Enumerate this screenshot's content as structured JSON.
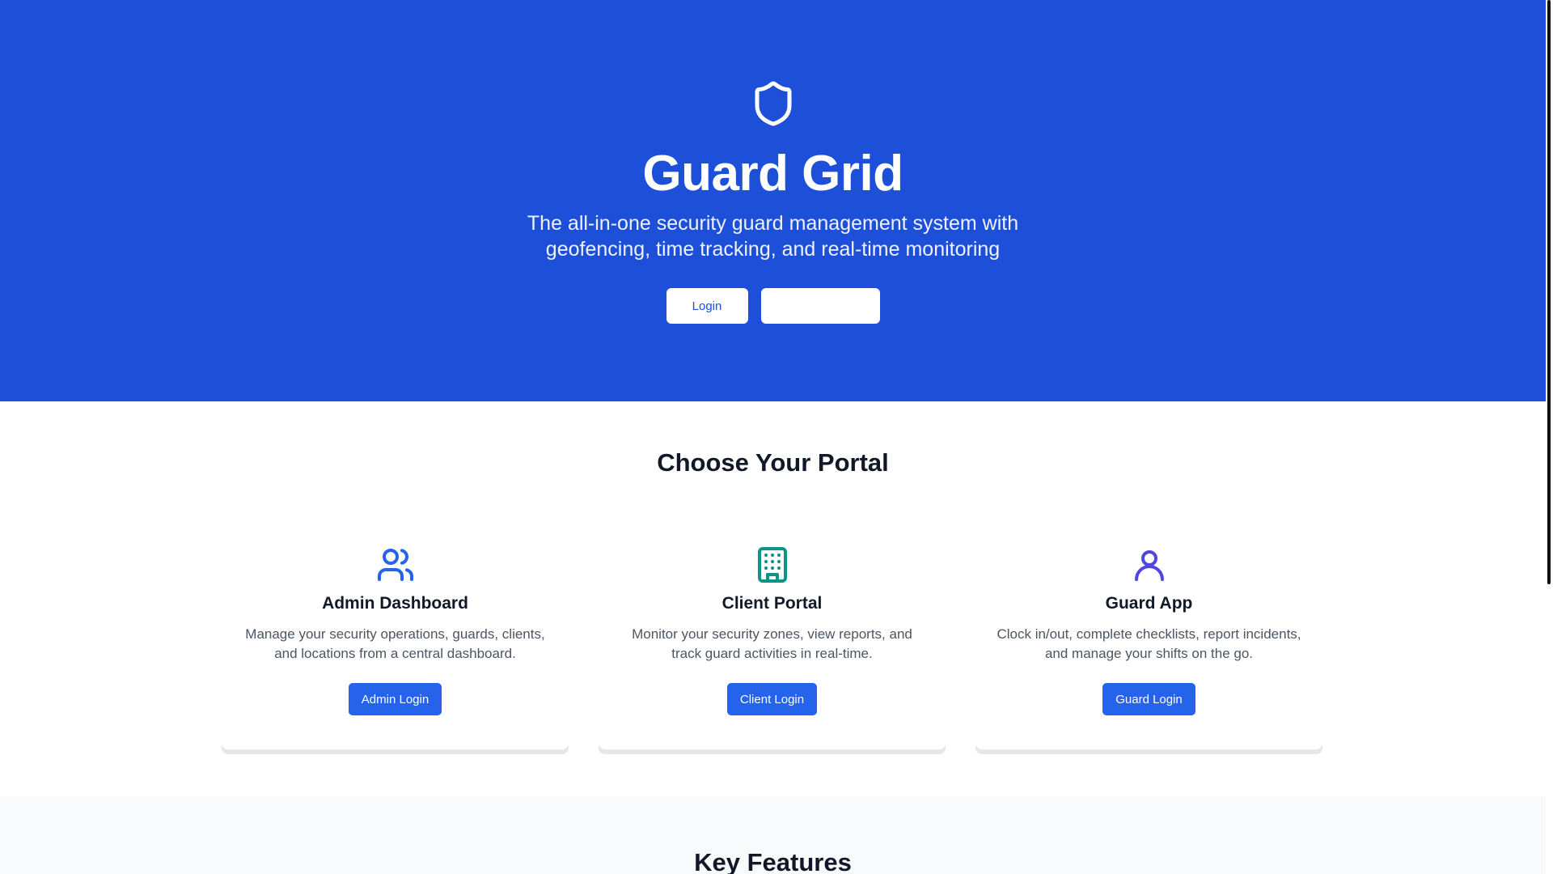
{
  "hero": {
    "icon": "shield-icon",
    "title": "Guard Grid",
    "subtitle": "The all-in-one security guard management system with geofencing, time tracking, and real-time monitoring",
    "login_label": "Login",
    "secondary_label": ""
  },
  "portals": {
    "heading": "Choose Your Portal",
    "cards": [
      {
        "icon": "users-icon",
        "title": "Admin Dashboard",
        "description": "Manage your security operations, guards, clients, and locations from a central dashboard.",
        "button": "Admin Login",
        "icon_color": "#2563eb"
      },
      {
        "icon": "building-icon",
        "title": "Client Portal",
        "description": "Monitor your security zones, view reports, and track guard activities in real-time.",
        "button": "Client Login",
        "icon_color": "#0d9488"
      },
      {
        "icon": "user-icon",
        "title": "Guard App",
        "description": "Clock in/out, complete checklists, report incidents, and manage your shifts on the go.",
        "button": "Guard Login",
        "icon_color": "#4f46e5"
      }
    ]
  },
  "features": {
    "heading": "Key Features"
  },
  "colors": {
    "hero_bg": "#1d4fd8",
    "primary_button": "#2563eb",
    "features_bg": "#f8fafc"
  }
}
